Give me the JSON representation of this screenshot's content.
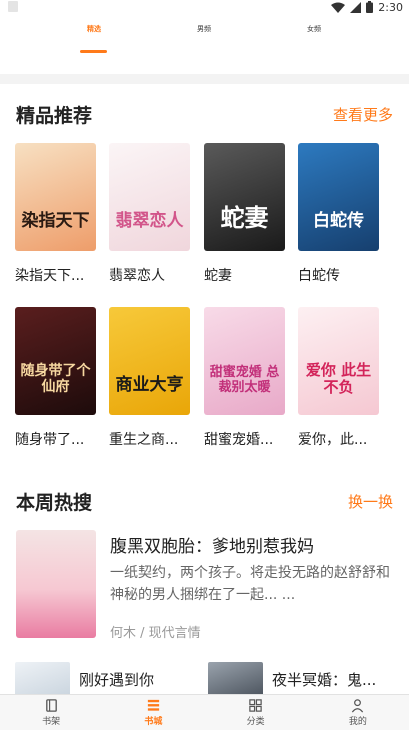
{
  "status_bar": {
    "time": "2:30",
    "icons": [
      "wifi-icon",
      "cell-signal-icon",
      "battery-icon"
    ]
  },
  "top_tabs": [
    {
      "label": "精选",
      "active": true
    },
    {
      "label": "男频",
      "active": false
    },
    {
      "label": "女频",
      "active": false
    }
  ],
  "featured": {
    "title": "精品推荐",
    "more_label": "查看更多",
    "books": [
      {
        "title": "染指天下...",
        "cover_text": "染指天下",
        "cover_color": "#f2c89a"
      },
      {
        "title": "翡翠恋人",
        "cover_text": "翡翠恋人",
        "cover_color": "#f6eef0"
      },
      {
        "title": "蛇妻",
        "cover_text": "蛇妻",
        "cover_color": "#3a3a3a"
      },
      {
        "title": "白蛇传",
        "cover_text": "白蛇传",
        "cover_color": "#1f5f9e"
      },
      {
        "title": "随身带了...",
        "cover_text": "随身带了个仙府",
        "cover_color": "#3b1515"
      },
      {
        "title": "重生之商...",
        "cover_text": "商业大亨",
        "cover_color": "#f0b81a"
      },
      {
        "title": "甜蜜宠婚...",
        "cover_text": "甜蜜宠婚 总裁别太暖",
        "cover_color": "#f3c9de"
      },
      {
        "title": "爱你，此...",
        "cover_text": "爱你 此生不负",
        "cover_color": "#fae3e7"
      }
    ]
  },
  "hot": {
    "title": "本周热搜",
    "refresh_label": "换一换",
    "main_book": {
      "title": "腹黑双胞胎：爹地别惹我妈",
      "desc": "一纸契约，两个孩子。将走投无路的赵舒舒和神秘的男人捆绑在了一起... ...",
      "author_category": "何木 / 现代言情"
    },
    "small_books": [
      {
        "title": "刚好遇到你"
      },
      {
        "title": "夜半冥婚：鬼..."
      }
    ]
  },
  "bottom_nav": [
    {
      "label": "书架",
      "active": false,
      "icon": "bookshelf-icon"
    },
    {
      "label": "书城",
      "active": true,
      "icon": "bookstore-icon"
    },
    {
      "label": "分类",
      "active": false,
      "icon": "grid-icon"
    },
    {
      "label": "我的",
      "active": false,
      "icon": "person-icon"
    }
  ],
  "colors": {
    "accent": "#ff7a1a",
    "text": "#222222",
    "muted": "#666666"
  }
}
